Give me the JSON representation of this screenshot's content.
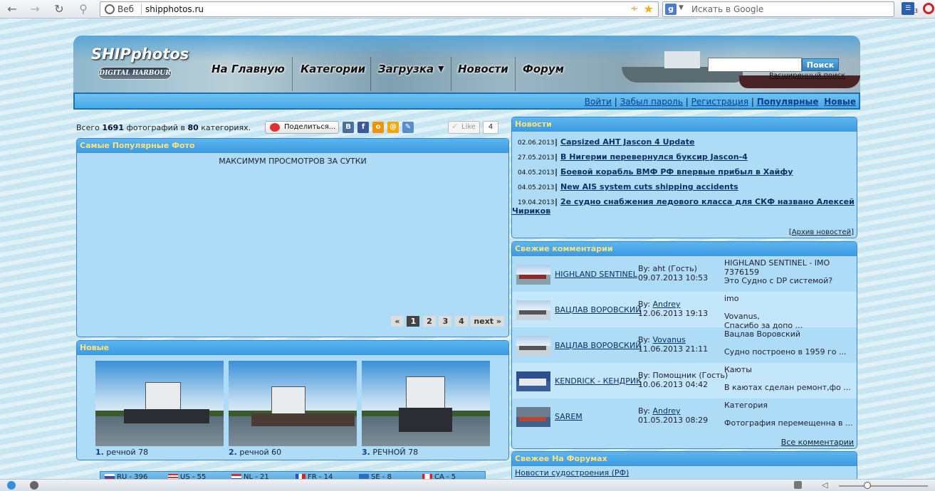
{
  "browser": {
    "web_label": "Веб",
    "url": "shipphotos.ru",
    "search_placeholder": "Искать в Google",
    "ext_count": "3"
  },
  "site": {
    "logo_title": "SHIPphotos",
    "logo_subtitle": "DIGITAL HARBOUR",
    "nav": [
      "На Главную",
      "Категории",
      "Загрузка",
      "Новости",
      "Форум"
    ],
    "search_button": "Поиск",
    "advanced_search": "Расширенный поиск"
  },
  "userbar": {
    "login": "Войти",
    "forgot": "Забыл пароль",
    "register": "Регистрация",
    "popular": "Популярные",
    "new": "Новые"
  },
  "stats": {
    "prefix": "Всего",
    "photos": "1691",
    "middle": "фотографий в",
    "categories": "80",
    "suffix": "категориях."
  },
  "share": {
    "button": "Поделиться...",
    "like": "Like",
    "like_count": "4",
    "icons": [
      "vk-icon",
      "facebook-icon",
      "odnoklassniki-icon",
      "mail-icon",
      "livejournal-icon"
    ]
  },
  "popular": {
    "title": "Самые Популярные Фото",
    "subtitle": "МАКСИМУМ ПРОСМОТРОВ ЗА СУТКИ",
    "pager": [
      "«",
      "1",
      "2",
      "3",
      "4",
      "next »"
    ]
  },
  "newest": {
    "title": "Новые",
    "items": [
      {
        "num": "1.",
        "label": "речной 78"
      },
      {
        "num": "2.",
        "label": "речной 60"
      },
      {
        "num": "3.",
        "label": "РЕЧНОЙ 78"
      }
    ]
  },
  "flags": [
    "RU - 396",
    "US - 55",
    "NL - 21",
    "FR - 14",
    "SE - 8",
    "CA - 5"
  ],
  "news": {
    "title": "Новости",
    "items": [
      {
        "date": "02.06.2013",
        "title": "Capsized AHT Jascon 4 Update"
      },
      {
        "date": "27.05.2013",
        "title": "В Нигерии перевернулся буксир Jascon-4"
      },
      {
        "date": "04.05.2013",
        "title": "Боевой корабль ВМФ РФ впервые прибыл в Хайфу"
      },
      {
        "date": "04.05.2013",
        "title": "New AIS system cuts shipping accidents"
      },
      {
        "date": "19.04.2013",
        "title": "2е судно снабжения ледового класса для СКФ названо Алексей",
        "title_cont": "Чириков"
      }
    ],
    "archive": "Архив новостей"
  },
  "comments": {
    "title": "Свежие комментарии",
    "items": [
      {
        "photo": "HIGHLAND SENTINEL",
        "by_label": "By:",
        "author": "aht (Гость)",
        "author_link": false,
        "date": "09.07.2013 10:53",
        "line1": "HIGHLAND SENTINEL - IMO 7376159",
        "line2": "Это Судно с DP системой?"
      },
      {
        "photo": "ВАЦЛАВ ВОРОВСКИЙ",
        "by_label": "By:",
        "author": "Andrey",
        "author_link": true,
        "date": "12.06.2013 19:13",
        "line1": "imo",
        "line2": "Vovanus,",
        "line3": "Спасибо за допо ..."
      },
      {
        "photo": "ВАЦЛАВ ВОРОВСКИЙ",
        "by_label": "By:",
        "author": "Vovanus",
        "author_link": true,
        "date": "11.06.2013 21:11",
        "line1": "Вацлав Воровский",
        "line2": "Судно построено в 1959 го ..."
      },
      {
        "photo": "KENDRICK - КЕНДРИК",
        "by_label": "By:",
        "author": "Помощник (Гость)",
        "author_link": false,
        "date": "10.06.2013 04:42",
        "line1": "Каюты",
        "line2": "В каютах сделан ремонт,фо ..."
      },
      {
        "photo": "SAREM",
        "by_label": "By:",
        "author": "Andrey",
        "author_link": true,
        "date": "01.05.2013 08:29",
        "line1": "Категория",
        "line2": "Фотография перемещенна в ..."
      }
    ],
    "all": "Все комментарии"
  },
  "forums": {
    "title": "Свежее На Форумах",
    "items": [
      "Новости судостроения (РФ)"
    ]
  }
}
